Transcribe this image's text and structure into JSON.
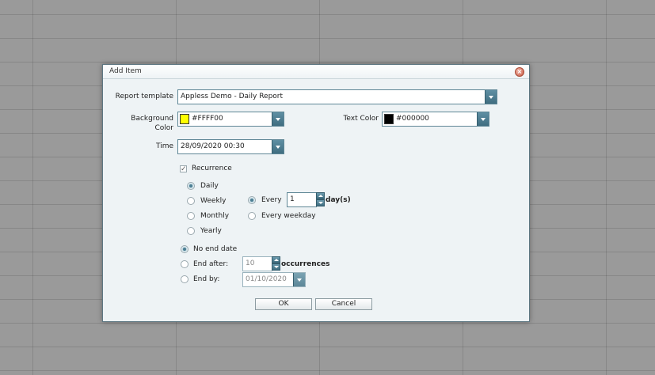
{
  "dialog": {
    "title": "Add Item",
    "close_icon": "close-icon"
  },
  "form": {
    "report_template_label": "Report template",
    "report_template_value": "Appless Demo - Daily Report",
    "background_color_label_1": "Background",
    "background_color_label_2": "Color",
    "background_color_value": "#FFFF00",
    "background_swatch": "#ffff00",
    "text_color_label": "Text Color",
    "text_color_value": "#000000",
    "text_swatch": "#000000",
    "time_label": "Time",
    "time_value": "28/09/2020 00:30"
  },
  "recurrence": {
    "checkbox_label": "Recurrence",
    "checked": true,
    "patterns": [
      "Daily",
      "Weekly",
      "Monthly",
      "Yearly"
    ],
    "selected_pattern": "Daily",
    "every_label": "Every",
    "every_value": "1",
    "every_unit": "day(s)",
    "every_weekday_label": "Every weekday"
  },
  "range": {
    "no_end_label": "No end date",
    "end_after_label": "End after:",
    "end_after_value": "10",
    "occurrences_label": "occurrences",
    "end_by_label": "End by:",
    "end_by_value": "01/10/2020",
    "selected": "No end date"
  },
  "buttons": {
    "ok": "OK",
    "cancel": "Cancel"
  }
}
